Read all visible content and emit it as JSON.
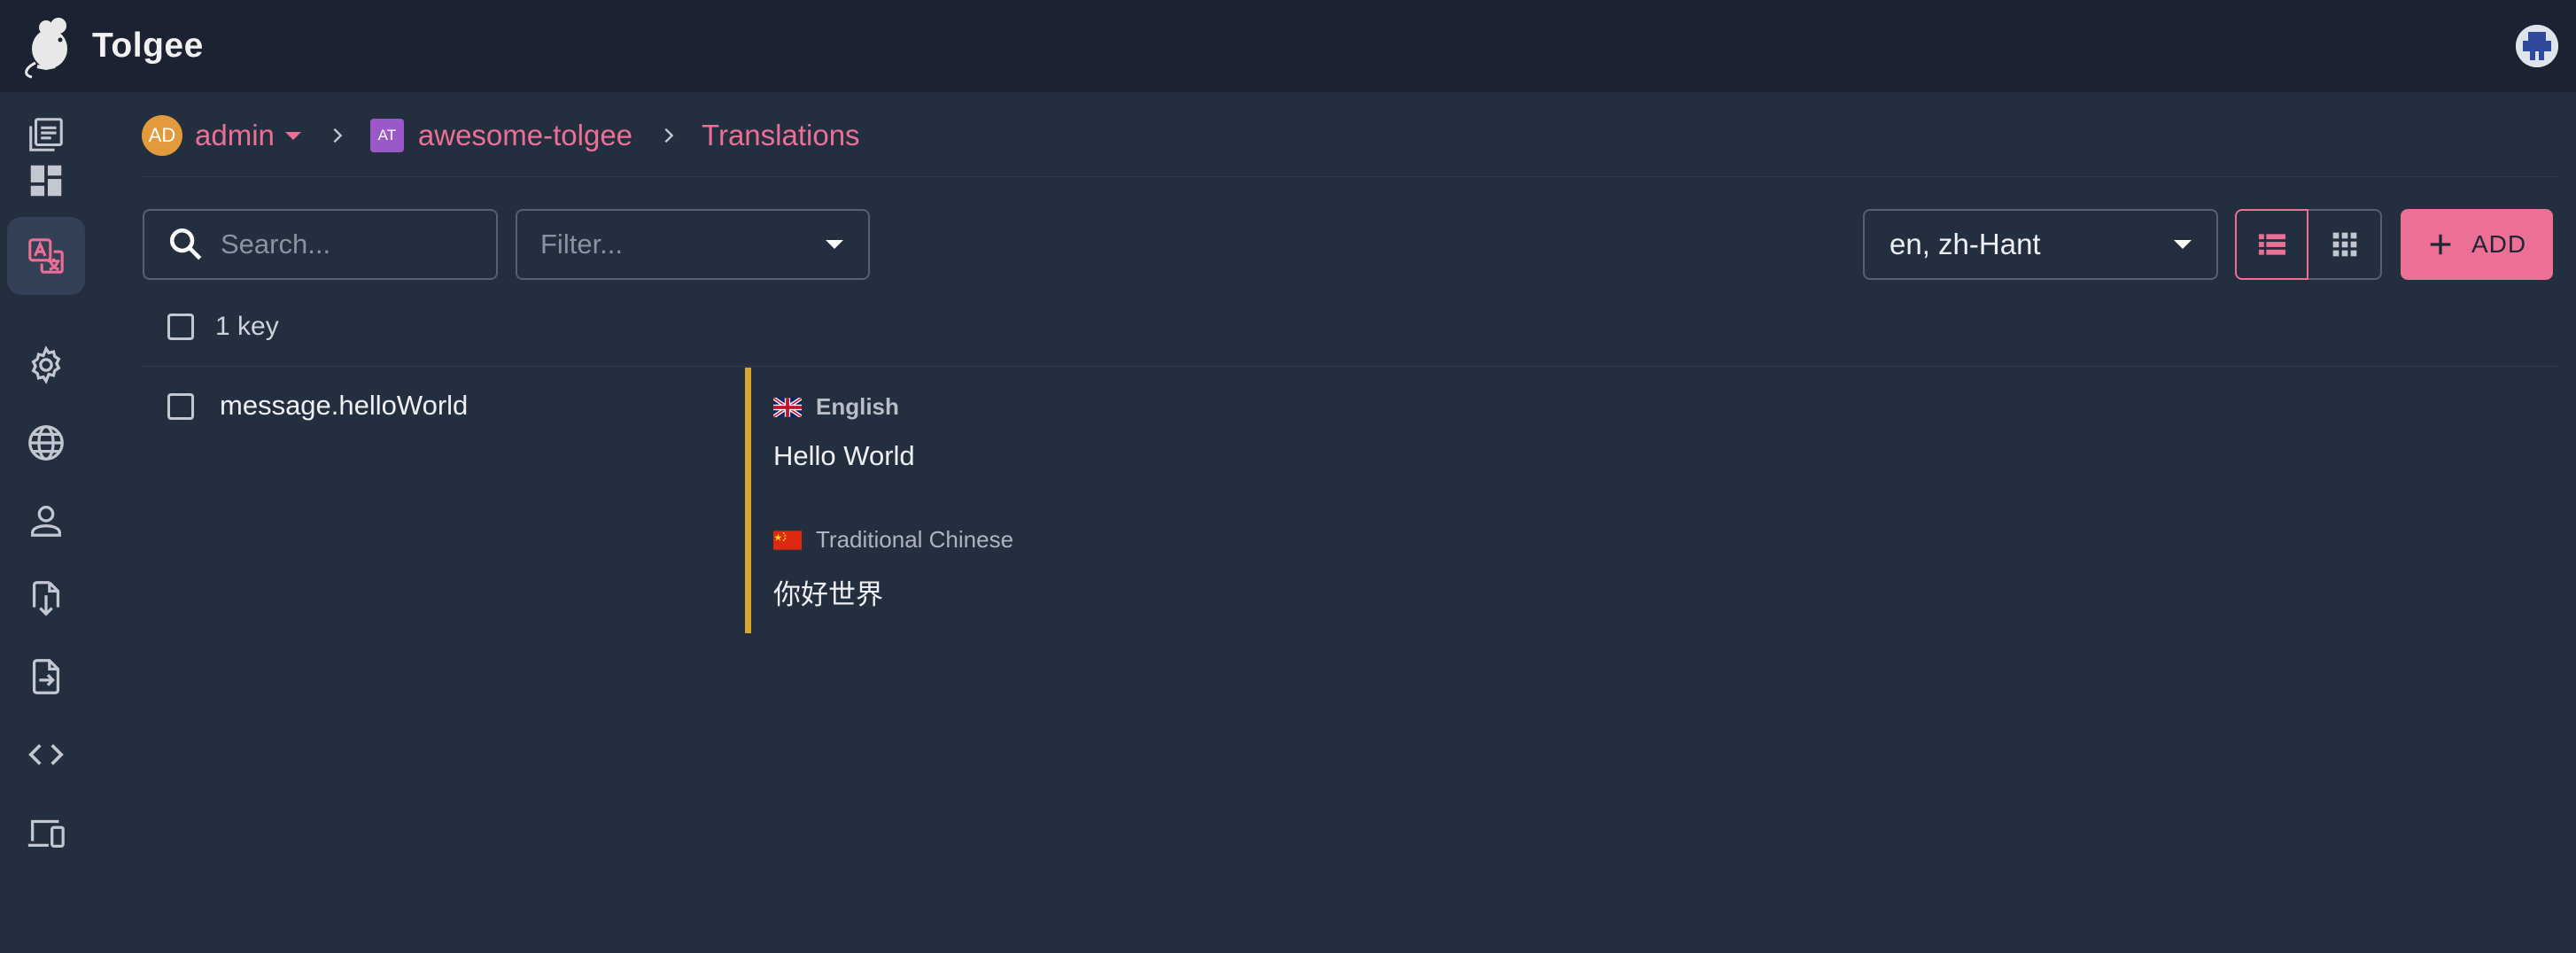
{
  "app": {
    "title": "Tolgee"
  },
  "sidenav": {
    "items": [
      {
        "icon": "projects-list-icon",
        "active": false
      },
      {
        "icon": "dashboard-icon",
        "active": false
      },
      {
        "icon": "translate-icon",
        "active": true
      },
      {
        "icon": "gear-icon",
        "active": false
      },
      {
        "icon": "globe-icon",
        "active": false
      },
      {
        "icon": "person-icon",
        "active": false
      },
      {
        "icon": "import-file-icon",
        "active": false
      },
      {
        "icon": "export-file-icon",
        "active": false
      },
      {
        "icon": "code-icon",
        "active": false
      },
      {
        "icon": "devices-icon",
        "active": false
      }
    ]
  },
  "breadcrumb": {
    "org_avatar": "AD",
    "org_name": "admin",
    "project_avatar": "AT",
    "project_name": "awesome-tolgee",
    "page": "Translations"
  },
  "toolbar": {
    "search_placeholder": "Search...",
    "filter_placeholder": "Filter...",
    "languages_value": "en, zh-Hant",
    "add_label": "ADD"
  },
  "list": {
    "key_count": "1 key",
    "rows": [
      {
        "key": "message.helloWorld",
        "translations": [
          {
            "language": "English",
            "text": "Hello World"
          },
          {
            "language": "Traditional Chinese",
            "text": "你好世界"
          }
        ]
      }
    ]
  },
  "colors": {
    "accent": "#ec6f96",
    "row_marker": "#d5a632",
    "background": "#232e3f",
    "topbar": "#1b2231"
  }
}
